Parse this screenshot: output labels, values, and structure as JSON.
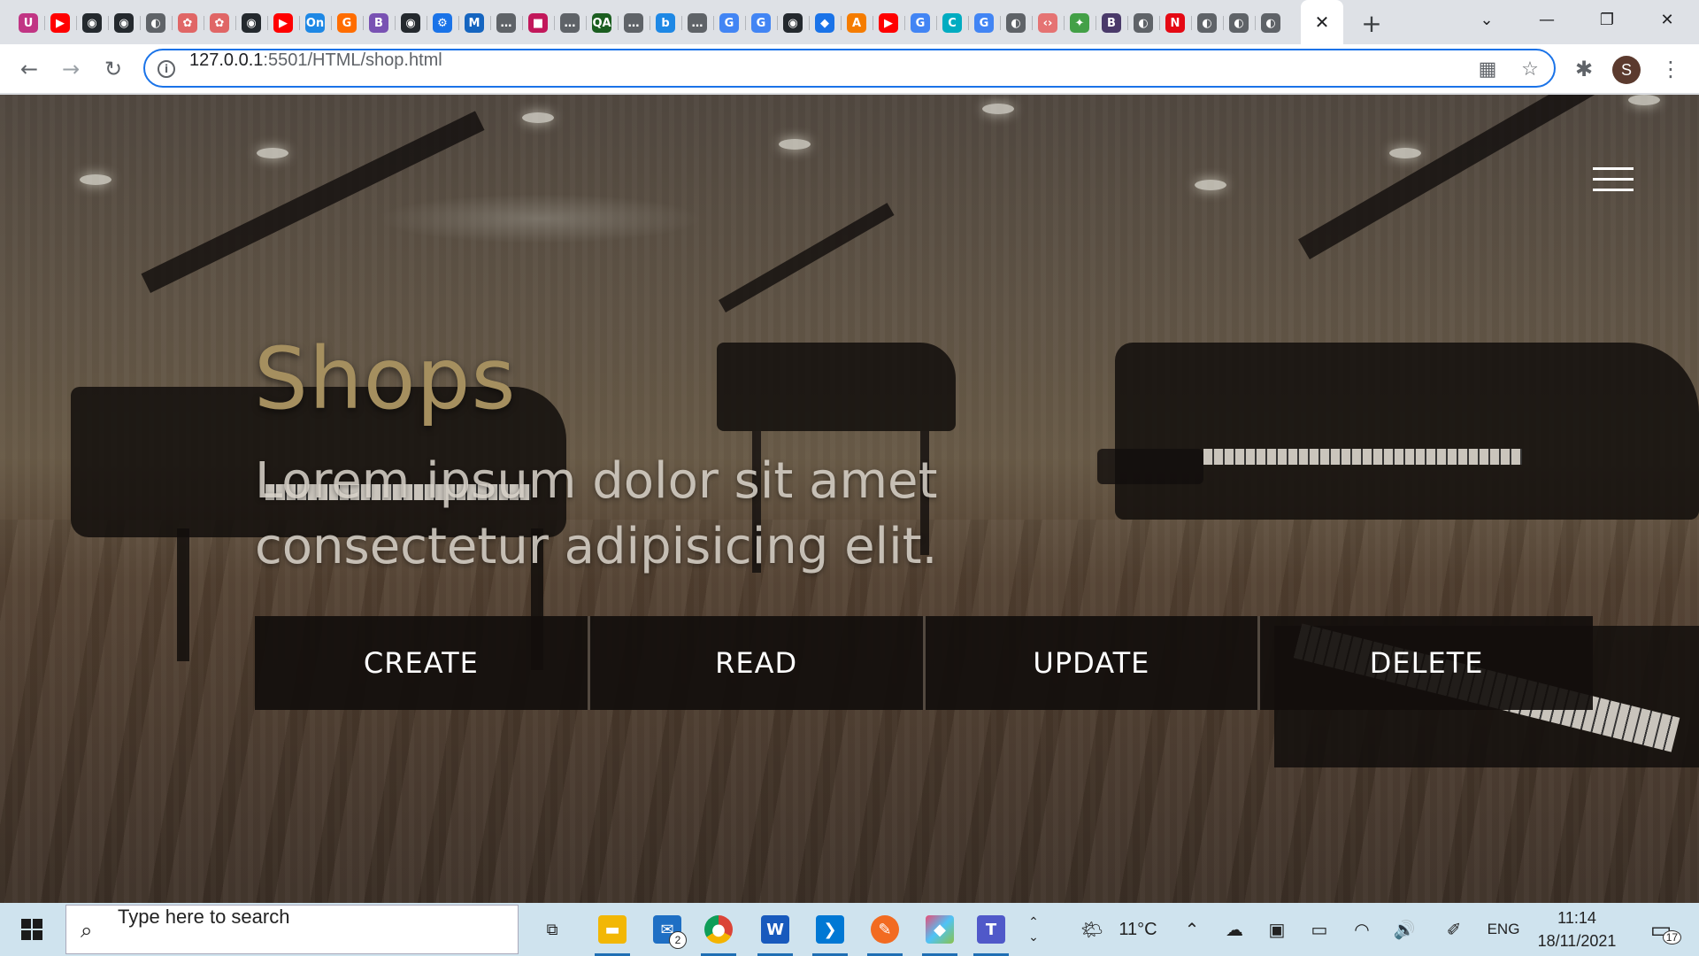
{
  "browser": {
    "pinned_tabs": [
      {
        "icon": "uplabs-icon",
        "glyph": "U",
        "color": "#c13584"
      },
      {
        "icon": "youtube-icon",
        "glyph": "▶",
        "color": "#ff0000"
      },
      {
        "icon": "github-icon",
        "glyph": "◉",
        "color": "#24292e"
      },
      {
        "icon": "github-icon",
        "glyph": "◉",
        "color": "#24292e"
      },
      {
        "icon": "globe-icon",
        "glyph": "◐",
        "color": "#5f6368"
      },
      {
        "icon": "chatgpt-icon",
        "glyph": "✿",
        "color": "#e06666"
      },
      {
        "icon": "chatgpt-icon",
        "glyph": "✿",
        "color": "#e06666"
      },
      {
        "icon": "github-icon",
        "glyph": "◉",
        "color": "#24292e"
      },
      {
        "icon": "youtube-icon",
        "glyph": "▶",
        "color": "#ff0000"
      },
      {
        "icon": "onshape-icon",
        "glyph": "On",
        "color": "#1e88e5"
      },
      {
        "icon": "g-icon",
        "glyph": "G",
        "color": "#ff6d00"
      },
      {
        "icon": "bootstrap-icon",
        "glyph": "B",
        "color": "#7952b3"
      },
      {
        "icon": "github-icon",
        "glyph": "◉",
        "color": "#24292e"
      },
      {
        "icon": "settings-icon",
        "glyph": "⚙",
        "color": "#1a73e8"
      },
      {
        "icon": "mdn-icon",
        "glyph": "M",
        "color": "#1565c0"
      },
      {
        "icon": "dots-icon",
        "glyph": "…",
        "color": "#5f6368"
      },
      {
        "icon": "square-icon",
        "glyph": "■",
        "color": "#c2185b"
      },
      {
        "icon": "dots-icon",
        "glyph": "…",
        "color": "#5f6368"
      },
      {
        "icon": "qa-icon",
        "glyph": "QA",
        "color": "#1b5e20"
      },
      {
        "icon": "dots-icon",
        "glyph": "…",
        "color": "#5f6368"
      },
      {
        "icon": "bing-icon",
        "glyph": "b",
        "color": "#1e88e5"
      },
      {
        "icon": "dots-icon",
        "glyph": "…",
        "color": "#5f6368"
      },
      {
        "icon": "google-icon",
        "glyph": "G",
        "color": "#4285f4"
      },
      {
        "icon": "google-icon",
        "glyph": "G",
        "color": "#4285f4"
      },
      {
        "icon": "github-icon",
        "glyph": "◉",
        "color": "#24292e"
      },
      {
        "icon": "diamond-icon",
        "glyph": "◆",
        "color": "#1a73e8"
      },
      {
        "icon": "orange-app-icon",
        "glyph": "A",
        "color": "#f57c00"
      },
      {
        "icon": "youtube-icon",
        "glyph": "▶",
        "color": "#ff0000"
      },
      {
        "icon": "google-icon",
        "glyph": "G",
        "color": "#4285f4"
      },
      {
        "icon": "c-icon",
        "glyph": "C",
        "color": "#00acc1"
      },
      {
        "icon": "google-icon",
        "glyph": "G",
        "color": "#4285f4"
      },
      {
        "icon": "globe-icon",
        "glyph": "◐",
        "color": "#5f6368"
      },
      {
        "icon": "code-icon",
        "glyph": "‹›",
        "color": "#e57373"
      },
      {
        "icon": "multicolor-icon",
        "glyph": "✦",
        "color": "#43a047"
      },
      {
        "icon": "bootstrap-icon",
        "glyph": "B",
        "color": "#4a3a6a"
      },
      {
        "icon": "globe-icon",
        "glyph": "◐",
        "color": "#5f6368"
      },
      {
        "icon": "netflix-icon",
        "glyph": "N",
        "color": "#e50914"
      },
      {
        "icon": "globe-icon",
        "glyph": "◐",
        "color": "#5f6368"
      },
      {
        "icon": "globe-icon",
        "glyph": "◐",
        "color": "#5f6368"
      },
      {
        "icon": "globe-icon",
        "glyph": "◐",
        "color": "#5f6368"
      }
    ],
    "active_tab_close": "✕",
    "new_tab": "+",
    "window_controls": {
      "tab_search": "⌄",
      "minimize": "—",
      "restore": "❐",
      "close": "✕"
    },
    "address": {
      "host": "127.0.0.1",
      "path": ":5501/HTML/shop.html"
    },
    "profile_initial": "S"
  },
  "page": {
    "title": "Shops",
    "subtitle": "Lorem ipsum dolor sit amet consectetur adipisicing elit.",
    "buttons": {
      "create": "CREATE",
      "read": "READ",
      "update": "UPDATE",
      "delete": "DELETE"
    }
  },
  "taskbar": {
    "search_placeholder": "Type here to search",
    "mail_badge": "2",
    "weather": "11°C",
    "language": "ENG",
    "time": "11:14",
    "date": "18/11/2021",
    "notifications": "17"
  }
}
